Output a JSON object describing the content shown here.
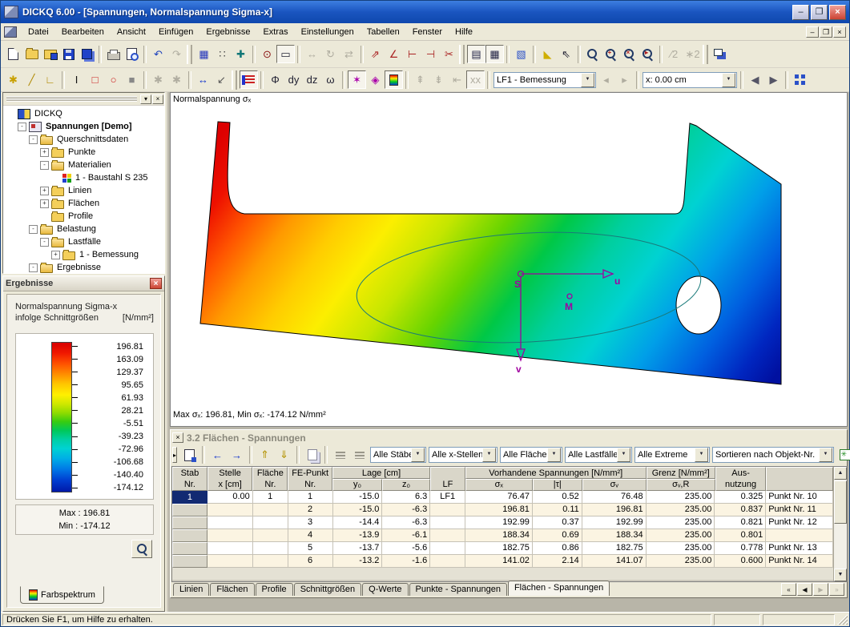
{
  "window": {
    "title": "DICKQ 6.00 - [Spannungen, Normalspannung Sigma-x]",
    "controls": {
      "minimize": "–",
      "restore": "❐",
      "close": "×"
    },
    "status_bar": "Drücken Sie F1, um Hilfe zu erhalten."
  },
  "menu": [
    "Datei",
    "Bearbeiten",
    "Ansicht",
    "Einfügen",
    "Ergebnisse",
    "Extras",
    "Einstellungen",
    "Tabellen",
    "Fenster",
    "Hilfe"
  ],
  "toolbar_row1": [
    {
      "n": "new-file",
      "k": "page"
    },
    {
      "n": "open-file",
      "k": "folder"
    },
    {
      "n": "open-project",
      "k": "folderdisk"
    },
    {
      "n": "save",
      "k": "disk"
    },
    {
      "n": "save-all",
      "k": "disk2"
    },
    {
      "sep": 1
    },
    {
      "n": "print",
      "k": "printer"
    },
    {
      "n": "print-preview",
      "k": "preview"
    },
    {
      "sep": 1
    },
    {
      "n": "undo",
      "g": "↶",
      "c": "#1a3fbb"
    },
    {
      "n": "redo",
      "g": "↷",
      "d": 1
    },
    {
      "grip": 1
    },
    {
      "n": "show-grid",
      "g": "▦",
      "c": "#2233bb"
    },
    {
      "n": "snap-grid",
      "g": "∷",
      "c": "#444"
    },
    {
      "n": "center-cross",
      "g": "✚",
      "c": "#117777"
    },
    {
      "sep": 1
    },
    {
      "n": "snap-pin",
      "g": "⊙",
      "c": "#8a1111"
    },
    {
      "n": "select-rect",
      "g": "▭",
      "p": 1
    },
    {
      "sep": 1
    },
    {
      "n": "move-object",
      "g": "↔",
      "d": 1
    },
    {
      "n": "rotate-object",
      "g": "↻",
      "d": 1
    },
    {
      "n": "mirror-object",
      "g": "⇄",
      "d": 1
    },
    {
      "sep": 1
    },
    {
      "n": "move-node",
      "g": "⇗",
      "c": "#aa2222"
    },
    {
      "n": "edit-corner",
      "g": "∠",
      "c": "#aa2222"
    },
    {
      "n": "extend-line",
      "g": "⊢",
      "c": "#aa2222"
    },
    {
      "n": "trim-line",
      "g": "⊣",
      "c": "#aa2222"
    },
    {
      "n": "divide-line",
      "g": "✂",
      "c": "#aa2222"
    },
    {
      "grip": 1
    },
    {
      "n": "navigator-panel",
      "g": "▤",
      "p": 1,
      "c": "#224"
    },
    {
      "n": "table-panel-toggle",
      "g": "▦",
      "p": 1,
      "c": "#224"
    },
    {
      "sep": 1
    },
    {
      "n": "print-graphic",
      "g": "▧",
      "c": "#2a50c8"
    },
    {
      "sep": 1
    },
    {
      "n": "zoom-polygon",
      "g": "◣",
      "c": "#cfae00"
    },
    {
      "n": "select-add",
      "g": "⇖",
      "c": "#223"
    },
    {
      "sep": 1
    },
    {
      "n": "zoom-window",
      "k": "zoom",
      "sub": ""
    },
    {
      "n": "zoom-in",
      "k": "zoom",
      "sub": "+"
    },
    {
      "n": "zoom-out",
      "k": "zoom",
      "sub": "×"
    },
    {
      "n": "zoom-dynamic",
      "k": "zoom",
      "sub": "▸"
    },
    {
      "sep": 1
    },
    {
      "n": "scale-half",
      "g": "∕2",
      "d": 1
    },
    {
      "n": "scale-double",
      "g": "∗2",
      "d": 1
    },
    {
      "grip": 1
    },
    {
      "n": "cascade-windows",
      "k": "cascade"
    }
  ],
  "toolbar_row2": [
    {
      "n": "new-point",
      "g": "✱",
      "c": "#c8a000"
    },
    {
      "n": "new-line",
      "g": "╱",
      "c": "#b08800"
    },
    {
      "n": "new-polyline",
      "g": "∟",
      "c": "#b08800"
    },
    {
      "sep": 1
    },
    {
      "n": "profile-i",
      "g": "I",
      "c": "#111"
    },
    {
      "n": "profile-rect",
      "g": "□",
      "c": "#cc2222"
    },
    {
      "n": "profile-circle",
      "g": "○",
      "c": "#cc2222"
    },
    {
      "n": "profile-plate",
      "g": "■",
      "c": "#888"
    },
    {
      "sep": 1
    },
    {
      "n": "round-corner",
      "g": "✱",
      "d": 1
    },
    {
      "n": "notch-corner",
      "g": "✱",
      "d": 1
    },
    {
      "sep": 1
    },
    {
      "n": "dimension-x",
      "g": "↔",
      "c": "#1133cc"
    },
    {
      "n": "dimension-arrow",
      "g": "↙",
      "c": "#555"
    },
    {
      "grip": 1
    },
    {
      "n": "numbering",
      "k": "numbering",
      "p": 1
    },
    {
      "sep": 1
    },
    {
      "n": "result-phi",
      "g": "Φ",
      "c": "#223"
    },
    {
      "n": "result-dy",
      "g": "dy",
      "c": "#223"
    },
    {
      "n": "result-dz",
      "g": "dz",
      "c": "#223"
    },
    {
      "n": "result-omega",
      "g": "ω",
      "c": "#223"
    },
    {
      "sep": 1
    },
    {
      "n": "result-trajectories",
      "g": "✶",
      "c": "#aa00aa",
      "p": 1
    },
    {
      "n": "result-deformation",
      "g": "◈",
      "c": "#aa00aa"
    },
    {
      "n": "color-spectrum-panel",
      "k": "spectrum",
      "p": 1
    },
    {
      "sep": 1
    },
    {
      "n": "result-max-values",
      "g": "⇞",
      "d": 1
    },
    {
      "n": "result-min-values",
      "g": "⇟",
      "d": 1
    },
    {
      "n": "result-limit-values",
      "g": "⇤",
      "d": 1
    },
    {
      "n": "result-hide-values",
      "g": "xx",
      "d": 1,
      "p": 1
    },
    {
      "sep": 1
    },
    {
      "n": "loadcase-select",
      "dd": 1,
      "v": "LF1 - Bemessung",
      "w": 128
    },
    {
      "n": "prev-loadcase",
      "g": "◂",
      "d": 1
    },
    {
      "n": "next-loadcase",
      "g": "▸",
      "d": 1
    },
    {
      "sep": 1
    },
    {
      "n": "x-position-select",
      "dd": 1,
      "v": "x: 0.00 cm",
      "w": 118
    },
    {
      "sep": 1
    },
    {
      "n": "prev-x",
      "g": "◀",
      "c": "#556"
    },
    {
      "n": "next-x",
      "g": "▶",
      "c": "#556"
    },
    {
      "sep": 1
    },
    {
      "n": "work-window-layout",
      "k": "quad"
    }
  ],
  "tree": {
    "items": [
      {
        "level": 0,
        "icon": "app",
        "expander": "",
        "label": "DICKQ"
      },
      {
        "level": 1,
        "icon": "project",
        "expander": "-",
        "label": "Spannungen [Demo]",
        "bold": true
      },
      {
        "level": 2,
        "icon": "folder-open",
        "expander": "-",
        "label": "Querschnittsdaten"
      },
      {
        "level": 3,
        "icon": "folder",
        "expander": "+",
        "label": "Punkte"
      },
      {
        "level": 3,
        "icon": "folder-open",
        "expander": "-",
        "label": "Materialien"
      },
      {
        "level": 4,
        "icon": "material",
        "expander": "",
        "label": "1 - Baustahl S 235"
      },
      {
        "level": 3,
        "icon": "folder",
        "expander": "+",
        "label": "Linien"
      },
      {
        "level": 3,
        "icon": "folder",
        "expander": "+",
        "label": "Flächen"
      },
      {
        "level": 3,
        "icon": "folder",
        "expander": "",
        "label": "Profile"
      },
      {
        "level": 2,
        "icon": "folder-open",
        "expander": "-",
        "label": "Belastung"
      },
      {
        "level": 3,
        "icon": "folder-open",
        "expander": "-",
        "label": "Lastfälle"
      },
      {
        "level": 4,
        "icon": "folder",
        "expander": "+",
        "label": "1 - Bemessung"
      },
      {
        "level": 2,
        "icon": "folder-open",
        "expander": "-",
        "label": "Ergebnisse"
      }
    ]
  },
  "results_panel": {
    "title": "Ergebnisse",
    "close_glyph": "×",
    "caption_line1": "Normalspannung Sigma-x",
    "caption_line2": "infolge Schnittgrößen",
    "caption_unit": "[N/mm²]",
    "legend_values": [
      "196.81",
      "163.09",
      "129.37",
      "95.65",
      "61.93",
      "28.21",
      "-5.51",
      "-39.23",
      "-72.96",
      "-106.68",
      "-140.40",
      "-174.12"
    ],
    "max_label": "Max : 196.81",
    "min_label": "Min : -174.12",
    "tab_label": "Farbspektrum"
  },
  "viewport": {
    "top_label": "Normalspannung σₓ",
    "bottom_label": "Max σₓ: 196.81, Min σₓ: -174.12 N/mm²",
    "axis_u": "u",
    "axis_v": "v",
    "point_s": "S",
    "point_m": "M"
  },
  "table_panel": {
    "title": "3.2 Flächen - Spannungen",
    "close_glyph": "×",
    "toolbar": [
      {
        "n": "table-properties",
        "k": "pageedit"
      },
      {
        "sep": 1
      },
      {
        "n": "prev-object",
        "g": "←",
        "c": "#1133cc"
      },
      {
        "n": "next-object",
        "g": "→",
        "c": "#1133cc"
      },
      {
        "sep": 1
      },
      {
        "n": "jump-first",
        "g": "⇑",
        "c": "#b39200"
      },
      {
        "n": "jump-last",
        "g": "⇓",
        "c": "#b39200"
      },
      {
        "sep": 1
      },
      {
        "n": "copy-table",
        "k": "copy",
        "d": 1
      },
      {
        "sep": 1
      },
      {
        "n": "insert-rows",
        "k": "rows",
        "d": 1
      },
      {
        "n": "delete-rows",
        "k": "rows",
        "d": 1
      }
    ],
    "filters": [
      {
        "n": "filter-staebe",
        "v": "Alle Stäbe",
        "w": 70
      },
      {
        "n": "filter-x-stellen",
        "v": "Alle x-Stellen",
        "w": 86
      },
      {
        "n": "filter-flaechen",
        "v": "Alle Flächen",
        "w": 78
      },
      {
        "n": "filter-lastfaelle",
        "v": "Alle Lastfälle",
        "w": 84
      },
      {
        "n": "filter-extreme",
        "v": "Alle Extreme",
        "w": 94
      },
      {
        "n": "filter-sort",
        "v": "Sortieren nach Objekt-Nr.",
        "w": 152
      }
    ],
    "header": {
      "stab": [
        "Stab",
        "Nr."
      ],
      "stelle": [
        "Stelle",
        "x [cm]"
      ],
      "flaeche": [
        "Fläche",
        "Nr."
      ],
      "fe_punkt": [
        "FE-Punkt",
        "Nr."
      ],
      "lage": "Lage [cm]",
      "y0": "y₀",
      "z0": "z₀",
      "lf": "LF",
      "vorhandene": "Vorhandene Spannungen [N/mm²]",
      "sigma_x": "σₓ",
      "tau": "|τ|",
      "sigma_v": "σᵥ",
      "grenz": "Grenz [N/mm²]",
      "sigma_vr": "σᵥ,R",
      "aus": [
        "Aus-",
        "nutzung"
      ]
    },
    "rows": [
      [
        "1",
        "0.00",
        "1",
        "1",
        "-15.0",
        "6.3",
        "LF1",
        "76.47",
        "0.52",
        "76.48",
        "235.00",
        "0.325",
        "Punkt Nr. 10"
      ],
      [
        "",
        "",
        "",
        "2",
        "-15.0",
        "-6.3",
        "",
        "196.81",
        "0.11",
        "196.81",
        "235.00",
        "0.837",
        "Punkt Nr. 11"
      ],
      [
        "",
        "",
        "",
        "3",
        "-14.4",
        "-6.3",
        "",
        "192.99",
        "0.37",
        "192.99",
        "235.00",
        "0.821",
        "Punkt Nr. 12"
      ],
      [
        "",
        "",
        "",
        "4",
        "-13.9",
        "-6.1",
        "",
        "188.34",
        "0.69",
        "188.34",
        "235.00",
        "0.801",
        ""
      ],
      [
        "",
        "",
        "",
        "5",
        "-13.7",
        "-5.6",
        "",
        "182.75",
        "0.86",
        "182.75",
        "235.00",
        "0.778",
        "Punkt Nr. 13"
      ],
      [
        "",
        "",
        "",
        "6",
        "-13.2",
        "-1.6",
        "",
        "141.02",
        "2.14",
        "141.07",
        "235.00",
        "0.600",
        "Punkt Nr. 14"
      ]
    ],
    "tabs": [
      "Linien",
      "Flächen",
      "Profile",
      "Schnittgrößen",
      "Q-Werte",
      "Punkte - Spannungen",
      "Flächen - Spannungen"
    ],
    "active_tab_index": 6,
    "tab_nav": [
      {
        "n": "first-tab",
        "g": "«"
      },
      {
        "n": "prev-tab",
        "g": "◀"
      },
      {
        "n": "next-tab",
        "g": "▶",
        "d": 1
      },
      {
        "n": "last-tab",
        "g": "»",
        "d": 1
      }
    ]
  }
}
